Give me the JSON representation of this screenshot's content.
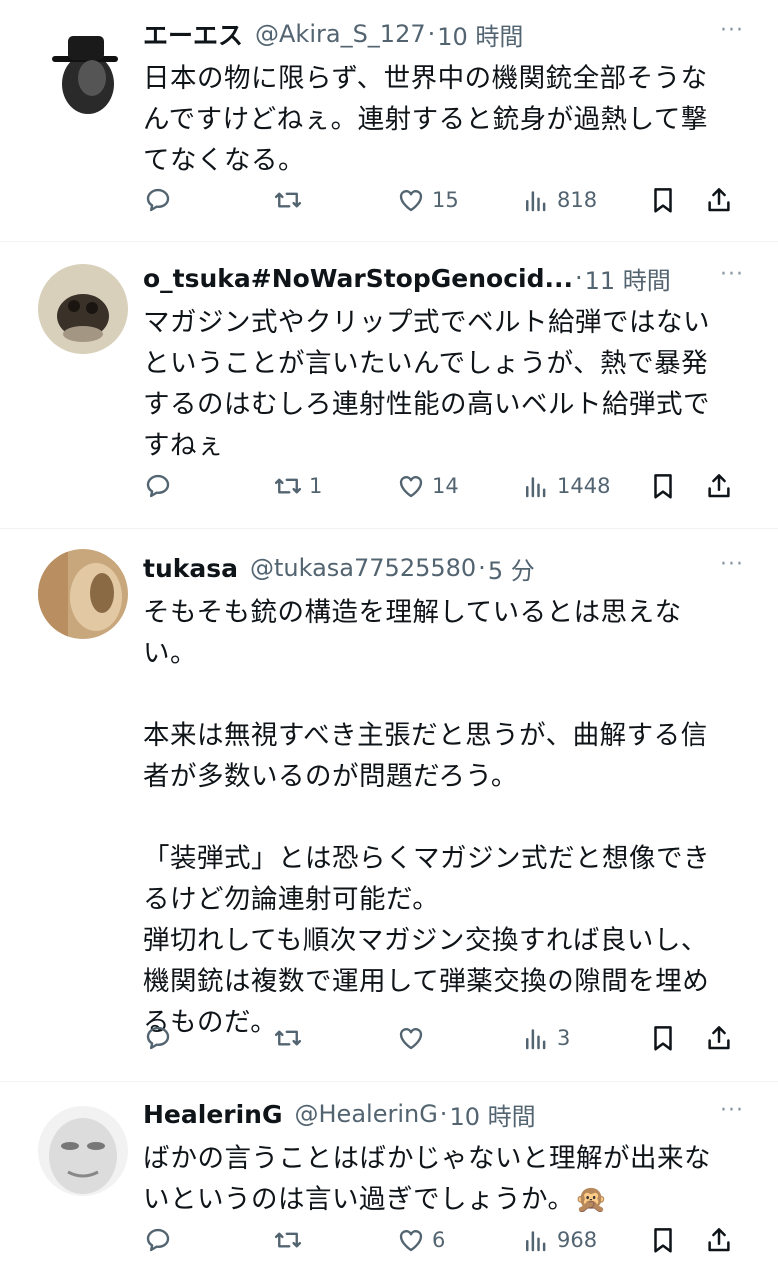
{
  "tweets": [
    {
      "name": "エーエス",
      "handle": "@Akira_S_127",
      "separator": "·",
      "time": "10 時間",
      "more": "···",
      "text": "日本の物に限らず、世界中の機関銃全部そうな\nんですけどねぇ。連射すると銃身が過熱して撃\nてなくなる。",
      "stats": {
        "reply": "",
        "retweet": "",
        "like": "15",
        "views": "818"
      }
    },
    {
      "name": "o_tsuka#NoWarStopGenocid...",
      "handle": "",
      "separator": "·",
      "time": "11 時間",
      "more": "···",
      "text": "マガジン式やクリップ式でベルト給弾ではない\nということが言いたいんでしょうが、熱で暴発\nするのはむしろ連射性能の高いベルト給弾式で\nすねぇ",
      "stats": {
        "reply": "",
        "retweet": "1",
        "like": "14",
        "views": "1448"
      }
    },
    {
      "name": "tukasa",
      "handle": "@tukasa77525580",
      "separator": "·",
      "time": "5 分",
      "more": "···",
      "text": "そもそも銃の構造を理解しているとは思えな\nい。\n\n本来は無視すべき主張だと思うが、曲解する信\n者が多数いるのが問題だろう。\n\n「装弾式」とは恐らくマガジン式だと想像でき\nるけど勿論連射可能だ。\n弾切れしても順次マガジン交換すれば良いし、\n機関銃は複数で運用して弾薬交換の隙間を埋め\nるものだ。",
      "stats": {
        "reply": "",
        "retweet": "",
        "like": "",
        "views": "3"
      }
    },
    {
      "name": "HealerinG",
      "handle": "@HealerinG",
      "separator": "·",
      "time": "10 時間",
      "more": "···",
      "text": "ばかの言うことはばかじゃないと理解が出来な\nいというのは言い過ぎでしょうか。🙊",
      "stats": {
        "reply": "",
        "retweet": "",
        "like": "6",
        "views": "968"
      }
    }
  ],
  "icons": [
    "reply-icon",
    "retweet-icon",
    "like-icon",
    "views-icon",
    "bookmark-icon",
    "share-icon"
  ],
  "colors": {
    "text": "#0f1419",
    "secondary": "#536471",
    "divider": "#eff3f4"
  }
}
